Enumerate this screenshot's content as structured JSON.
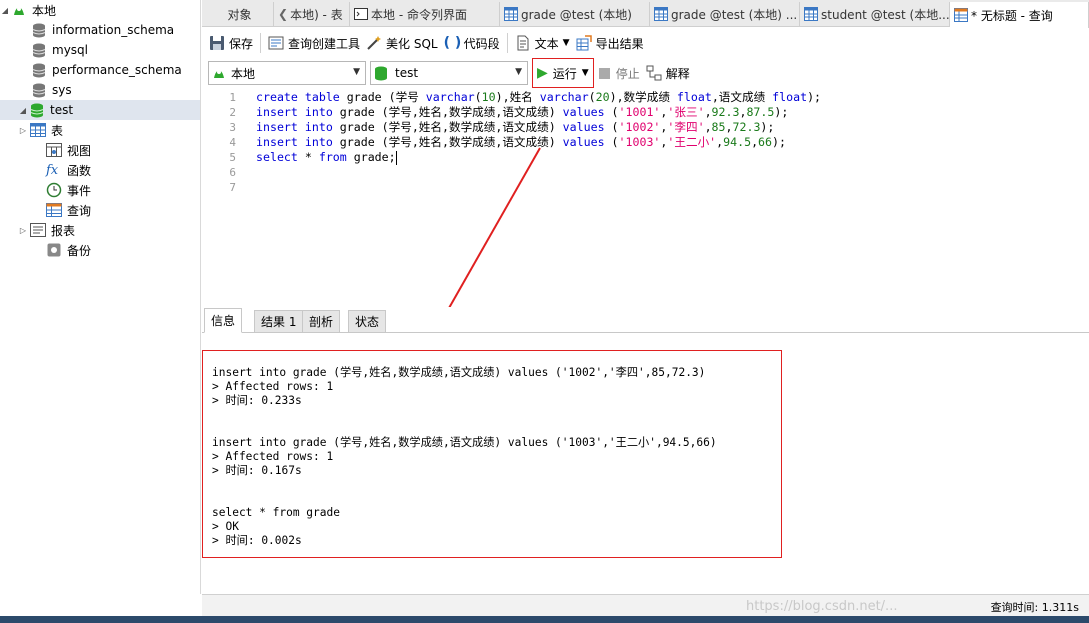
{
  "nav": {
    "connection": "本地",
    "databases": [
      "information_schema",
      "mysql",
      "performance_schema",
      "sys",
      "test"
    ],
    "children": [
      "表",
      "视图",
      "函数",
      "事件",
      "查询",
      "报表",
      "备份"
    ]
  },
  "tabs": [
    {
      "label": "对象"
    },
    {
      "label": "本地) - 表"
    },
    {
      "label": "本地 - 命令列界面"
    },
    {
      "label": "grade @test (本地)"
    },
    {
      "label": "grade @test (本地) ..."
    },
    {
      "label": "student @test (本地..."
    },
    {
      "label": "* 无标题 - 查询"
    }
  ],
  "toolbar1": {
    "save": "保存",
    "builder": "查询创建工具",
    "beautify": "美化 SQL",
    "snippet": "代码段",
    "text": "文本",
    "export": "导出结果"
  },
  "toolbar2": {
    "connection": "本地",
    "database": "test",
    "run": "运行",
    "stop": "停止",
    "explain": "解释"
  },
  "editor": {
    "line_numbers": [
      "1",
      "2",
      "3",
      "4",
      "5",
      "6",
      "7"
    ],
    "lines": [
      "create table grade (学号 varchar(10),姓名 varchar(20),数学成绩 float,语文成绩 float);",
      "insert into grade (学号,姓名,数学成绩,语文成绩) values ('1001','张三',92.3,87.5);",
      "insert into grade (学号,姓名,数学成绩,语文成绩) values ('1002','李四',85,72.3);",
      "insert into grade (学号,姓名,数学成绩,语文成绩) values ('1003','王二小',94.5,66);",
      "select * from grade;"
    ]
  },
  "result_tabs": [
    "信息",
    "结果 1",
    "剖析",
    "状态"
  ],
  "messages": [
    "insert into grade (学号,姓名,数学成绩,语文成绩) values ('1002','李四',85,72.3)",
    "> Affected rows: 1",
    "> 时间: 0.233s",
    "insert into grade (学号,姓名,数学成绩,语文成绩) values ('1003','王二小',94.5,66)",
    "> Affected rows: 1",
    "> 时间: 0.167s",
    "select * from grade",
    "> OK",
    "> 时间: 0.002s"
  ],
  "status": {
    "query_time": "查询时间: 1.311s",
    "watermark": "https://blog.csdn.net/..."
  },
  "colors": {
    "keyword": "#0000d8",
    "string": "#e0006e",
    "number": "#1a7a1a",
    "highlight": "#e02020",
    "db_green": "#2ea82e"
  }
}
